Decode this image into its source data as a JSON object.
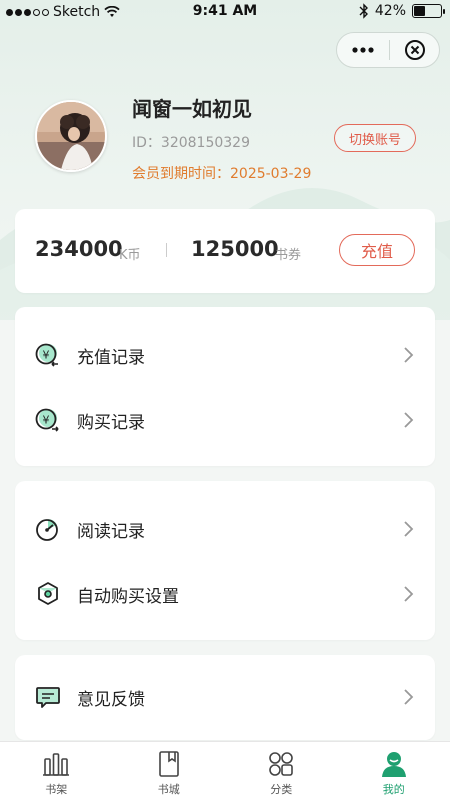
{
  "status_bar": {
    "carrier": "Sketch",
    "time": "9:41 AM",
    "battery": "42%",
    "battery_level": 0.42
  },
  "capsule": {
    "more_icon": "more-dots-icon",
    "close_icon": "close-circle-icon"
  },
  "profile": {
    "name": "闻窗一如初见",
    "id_text": "ID：3208150329",
    "expire_text": "会员到期时间：2025-03-29",
    "switch_label": "切换账号"
  },
  "balance": {
    "coins": "234000",
    "coins_unit": "K币",
    "vouchers": "125000",
    "vouchers_unit": "书券",
    "recharge_label": "充值"
  },
  "menu": {
    "group1": [
      {
        "label": "充值记录",
        "icon": "recharge-record-icon"
      },
      {
        "label": "购买记录",
        "icon": "purchase-record-icon"
      }
    ],
    "group2": [
      {
        "label": "阅读记录",
        "icon": "reading-record-icon"
      },
      {
        "label": "自动购买设置",
        "icon": "auto-buy-settings-icon"
      }
    ],
    "group3": [
      {
        "label": "意见反馈",
        "icon": "feedback-icon"
      }
    ]
  },
  "tabbar": {
    "tabs": [
      {
        "label": "书架",
        "icon": "bookshelf-icon",
        "active": false
      },
      {
        "label": "书城",
        "icon": "bookstore-icon",
        "active": false
      },
      {
        "label": "分类",
        "icon": "category-icon",
        "active": false
      },
      {
        "label": "我的",
        "icon": "profile-icon",
        "active": true
      }
    ]
  },
  "colors": {
    "accent_green": "#1fa070",
    "icon_green": "#5fd3a2",
    "accent_red": "#e05c4a",
    "expire_orange": "#e07c2e"
  }
}
